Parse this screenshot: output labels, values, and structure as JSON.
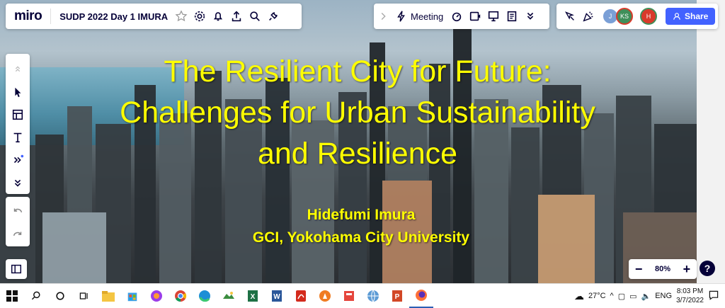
{
  "app": {
    "logo": "miro",
    "board_name": "SUDP 2022 Day 1 IMURA"
  },
  "toolbar_right": {
    "meeting_label": "Meeting",
    "share_label": "Share",
    "avatars": [
      {
        "initials": "J",
        "color": "#7a9fd6"
      },
      {
        "initials": "KS",
        "color": "#3f8f5a"
      },
      {
        "initials": "H",
        "color": "#d93a2b"
      }
    ]
  },
  "slide": {
    "title_line1": "The Resilient City for Future:",
    "title_line2": "Challenges for Urban Sustainability",
    "title_line3": "and Resilience",
    "author": "Hidefumi Imura",
    "affiliation": "GCI, Yokohama City University",
    "text_color": "#ffff00"
  },
  "zoom": {
    "minus": "−",
    "level": "80%",
    "plus": "+",
    "help": "?"
  },
  "taskbar": {
    "weather": "27°C",
    "language": "ENG",
    "time": "8:03 PM",
    "date": "3/7/2022"
  },
  "colors": {
    "accent": "#4262ff",
    "brand_dark": "#050038"
  }
}
